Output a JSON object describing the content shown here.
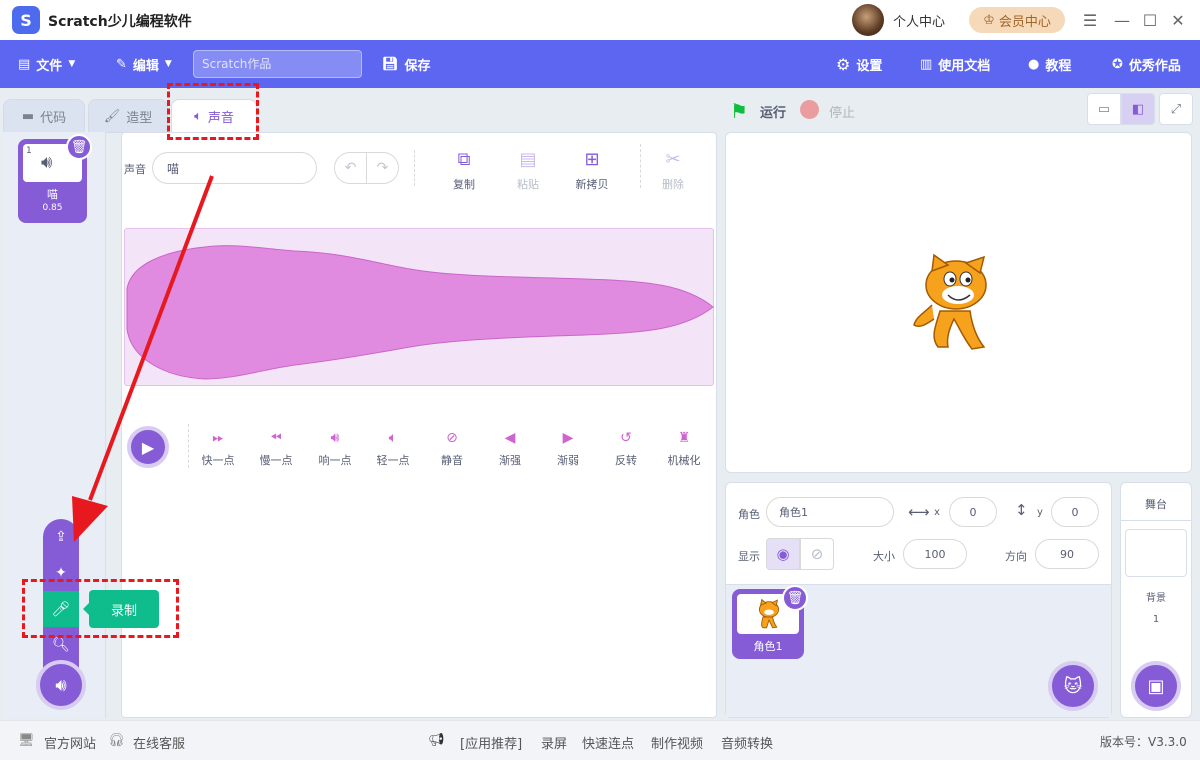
{
  "app": {
    "title": "Scratch少儿编程软件",
    "logo_letter": "S"
  },
  "titlebar": {
    "personal_center": "个人中心",
    "vip_center": "会员中心"
  },
  "menubar": {
    "file": "文件",
    "edit": "编辑",
    "project_placeholder": "Scratch作品",
    "save": "保存",
    "settings": "设置",
    "docs": "使用文档",
    "tutorial": "教程",
    "showcase": "优秀作品"
  },
  "tabs": [
    {
      "label": "代码"
    },
    {
      "label": "造型"
    },
    {
      "label": "声音"
    }
  ],
  "sound_list": [
    {
      "index": "1",
      "name": "喵",
      "duration": "0.85"
    }
  ],
  "editor": {
    "sound_label": "声音",
    "sound_name": "喵",
    "tools": {
      "copy": "复制",
      "paste": "粘贴",
      "copy_new": "新拷贝",
      "delete": "删除"
    },
    "effects": [
      "快一点",
      "慢一点",
      "响一点",
      "轻一点",
      "静音",
      "渐强",
      "渐弱",
      "反转",
      "机械化"
    ]
  },
  "add_sound_menu": {
    "record_tooltip": "录制"
  },
  "stage_controls": {
    "run": "运行",
    "stop": "停止"
  },
  "sprite_info": {
    "sprite_label": "角色",
    "sprite_name": "角色1",
    "x_label": "x",
    "x_value": "0",
    "y_label": "y",
    "y_value": "0",
    "show_label": "显示",
    "size_label": "大小",
    "size_value": "100",
    "direction_label": "方向",
    "direction_value": "90"
  },
  "sprites": [
    {
      "name": "角色1"
    }
  ],
  "stage_panel": {
    "title": "舞台",
    "backdrop_label": "背景",
    "backdrop_count": "1"
  },
  "bottombar": {
    "official_site": "官方网站",
    "online_service": "在线客服",
    "app_recommend": "[应用推荐]",
    "links": [
      "录屏",
      "快速连点",
      "制作视频",
      "音频转换"
    ],
    "version": "版本号：V3.3.0"
  },
  "colors": {
    "menu_bar": "#5c66f0",
    "sound_purple": "#855cd6",
    "record_green": "#0fbd8c",
    "annotation_red": "#e8191e",
    "waveform": "#cf63cf"
  }
}
